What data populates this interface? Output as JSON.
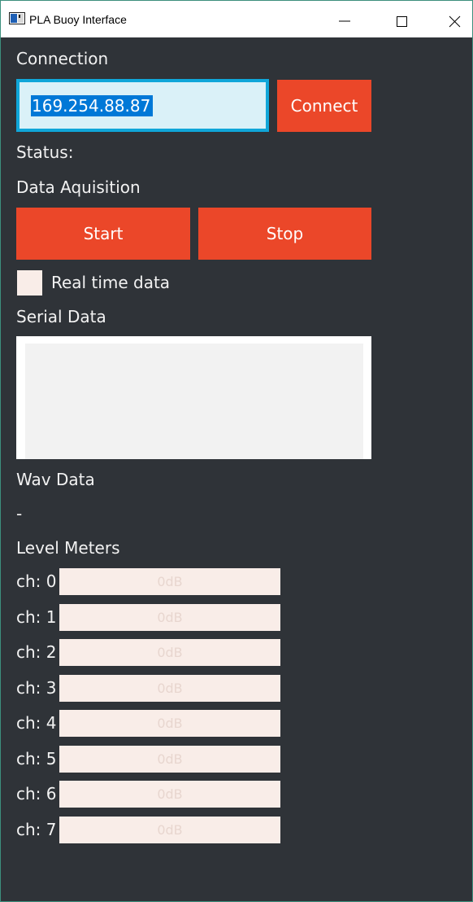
{
  "window": {
    "title": "PLA Buoy Interface"
  },
  "connection": {
    "heading": "Connection",
    "ip_value": "169.254.88.87",
    "connect_label": "Connect",
    "status_label": "Status:"
  },
  "acquisition": {
    "heading": "Data Aquisition",
    "start_label": "Start",
    "stop_label": "Stop",
    "realtime_label": "Real time data",
    "realtime_checked": false
  },
  "serial": {
    "heading": "Serial Data"
  },
  "wav": {
    "heading": "Wav Data",
    "value": "-"
  },
  "meters": {
    "heading": "Level Meters",
    "channels": [
      {
        "label": "ch: 0",
        "value": "0dB"
      },
      {
        "label": "ch: 1",
        "value": "0dB"
      },
      {
        "label": "ch: 2",
        "value": "0dB"
      },
      {
        "label": "ch: 3",
        "value": "0dB"
      },
      {
        "label": "ch: 4",
        "value": "0dB"
      },
      {
        "label": "ch: 5",
        "value": "0dB"
      },
      {
        "label": "ch: 6",
        "value": "0dB"
      },
      {
        "label": "ch: 7",
        "value": "0dB"
      }
    ]
  },
  "colors": {
    "accent": "#eb4729",
    "background": "#2f3338",
    "input_border": "#10a6d9",
    "selection": "#0078d7"
  },
  "icons": {
    "app": "app-window-icon",
    "minimize": "minimize-icon",
    "maximize": "maximize-icon",
    "close": "close-icon"
  }
}
